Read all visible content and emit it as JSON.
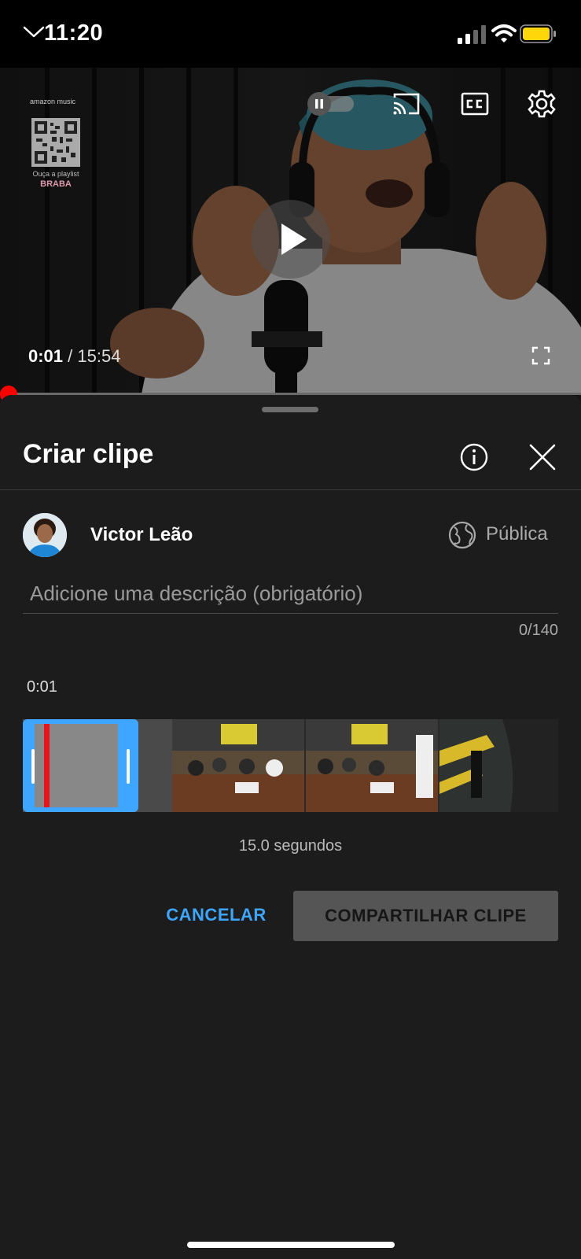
{
  "status_bar": {
    "time": "11:20"
  },
  "player": {
    "current_time": "0:01",
    "separator": " / ",
    "duration": "15:54",
    "overlay": {
      "brand_text": "amazon music",
      "qr_caption": "Ouça a playlist",
      "qr_brand": "BRABA"
    },
    "progress": 0.001
  },
  "sheet": {
    "title": "Criar clipe",
    "user": {
      "name": "Victor Leão",
      "visibility": "Pública"
    },
    "description": {
      "placeholder": "Adicione uma descrição (obrigatório)",
      "value": "",
      "counter": "0/140"
    },
    "clip_start": "0:01",
    "clip_length": "15.0 segundos",
    "buttons": {
      "cancel": "CANCELAR",
      "share": "COMPARTILHAR CLIPE"
    }
  },
  "colors": {
    "accent": "#3ea6ff",
    "progress": "#ff0000",
    "playhead": "#e8141b",
    "background": "#1c1c1c"
  },
  "icons": [
    "chevron-down-icon",
    "autoplay-toggle-icon",
    "cast-icon",
    "cc-icon",
    "gear-icon",
    "play-icon",
    "fullscreen-icon",
    "info-icon",
    "close-icon",
    "globe-icon"
  ]
}
